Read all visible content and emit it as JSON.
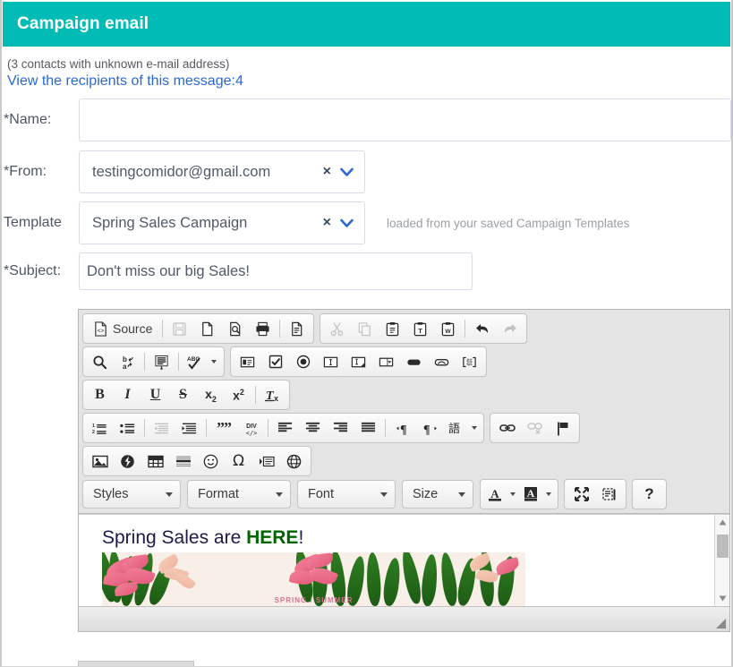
{
  "header": {
    "title": "Campaign email"
  },
  "info": {
    "unknown_note": "(3 contacts with unknown e-mail address)",
    "recipients_link": "View the recipients of this message:4"
  },
  "form": {
    "name": {
      "label": "*Name:",
      "value": "",
      "placeholder": ""
    },
    "from": {
      "label": "*From:",
      "value": "testingcomidor@gmail.com",
      "clear": "×"
    },
    "template": {
      "label": "Template",
      "value": "Spring Sales Campaign",
      "clear": "×",
      "hint": "loaded from your saved Campaign Templates"
    },
    "subject": {
      "label": "*Subject:",
      "value": "Don't miss our big Sales!",
      "placeholder": ""
    }
  },
  "editor": {
    "toolbar": {
      "rows": [
        {
          "groups": [
            {
              "items": [
                {
                  "name": "source-button",
                  "label": "Source",
                  "icon": "source-icon",
                  "disabled": false
                },
                {
                  "name": "separator",
                  "icon": "separator"
                },
                {
                  "name": "save-button",
                  "label": "",
                  "icon": "save-icon",
                  "disabled": true
                },
                {
                  "name": "new-page-button",
                  "label": "",
                  "icon": "new-page-icon",
                  "disabled": false
                },
                {
                  "name": "preview-button",
                  "label": "",
                  "icon": "preview-icon",
                  "disabled": false
                },
                {
                  "name": "print-button",
                  "label": "",
                  "icon": "print-icon",
                  "disabled": false
                },
                {
                  "name": "separator",
                  "icon": "separator"
                },
                {
                  "name": "templates-button",
                  "label": "",
                  "icon": "templates-icon",
                  "disabled": false
                }
              ]
            },
            {
              "items": [
                {
                  "name": "cut-button",
                  "label": "",
                  "icon": "scissors-icon",
                  "disabled": true
                },
                {
                  "name": "copy-button",
                  "label": "",
                  "icon": "copy-icon",
                  "disabled": true
                },
                {
                  "name": "paste-button",
                  "label": "",
                  "icon": "paste-icon",
                  "disabled": false
                },
                {
                  "name": "paste-text-button",
                  "label": "",
                  "icon": "paste-text-icon",
                  "disabled": false
                },
                {
                  "name": "paste-word-button",
                  "label": "",
                  "icon": "paste-word-icon",
                  "disabled": false
                },
                {
                  "name": "separator",
                  "icon": "separator"
                },
                {
                  "name": "undo-button",
                  "label": "",
                  "icon": "undo-arrow-icon",
                  "disabled": false
                },
                {
                  "name": "redo-button",
                  "label": "",
                  "icon": "redo-arrow-icon",
                  "disabled": true
                }
              ]
            }
          ]
        },
        {
          "groups": [
            {
              "items": [
                {
                  "name": "find-button",
                  "label": "",
                  "icon": "magnifier-icon",
                  "disabled": false
                },
                {
                  "name": "replace-button",
                  "label": "",
                  "icon": "replace-icon",
                  "disabled": false
                },
                {
                  "name": "separator",
                  "icon": "separator"
                },
                {
                  "name": "select-all-button",
                  "label": "",
                  "icon": "select-all-icon",
                  "disabled": false
                },
                {
                  "name": "separator",
                  "icon": "separator"
                },
                {
                  "name": "spellcheck-button",
                  "label": "",
                  "icon": "spellcheck-icon",
                  "disabled": false,
                  "caret": true
                }
              ]
            },
            {
              "items": [
                {
                  "name": "form-button",
                  "label": "",
                  "icon": "form-icon",
                  "disabled": false
                },
                {
                  "name": "checkbox-button",
                  "label": "",
                  "icon": "checkbox-icon",
                  "disabled": false
                },
                {
                  "name": "radio-button",
                  "label": "",
                  "icon": "radio-icon",
                  "disabled": false
                },
                {
                  "name": "text-field-button",
                  "label": "",
                  "icon": "text-field-icon",
                  "disabled": false
                },
                {
                  "name": "textarea-button",
                  "label": "",
                  "icon": "textarea-icon",
                  "disabled": false
                },
                {
                  "name": "select-field-button",
                  "label": "",
                  "icon": "select-field-icon",
                  "disabled": false
                },
                {
                  "name": "button-field-button",
                  "label": "",
                  "icon": "button-field-icon",
                  "disabled": false
                },
                {
                  "name": "image-button-button",
                  "label": "",
                  "icon": "image-button-icon",
                  "disabled": false
                },
                {
                  "name": "hidden-field-button",
                  "label": "",
                  "icon": "hidden-field-icon",
                  "disabled": false
                }
              ]
            }
          ]
        },
        {
          "groups": [
            {
              "items": [
                {
                  "name": "bold-button",
                  "label": "B",
                  "icon": "bold-icon",
                  "disabled": false
                },
                {
                  "name": "italic-button",
                  "label": "I",
                  "icon": "italic-icon",
                  "disabled": false
                },
                {
                  "name": "underline-button",
                  "label": "U",
                  "icon": "underline-icon",
                  "disabled": false
                },
                {
                  "name": "strikethrough-button",
                  "label": "S",
                  "icon": "strikethrough-icon",
                  "disabled": false
                },
                {
                  "name": "subscript-button",
                  "label": "x",
                  "icon": "subscript-icon",
                  "disabled": false
                },
                {
                  "name": "superscript-button",
                  "label": "x",
                  "icon": "superscript-icon",
                  "disabled": false
                },
                {
                  "name": "separator",
                  "icon": "separator"
                },
                {
                  "name": "remove-format-button",
                  "label": "",
                  "icon": "remove-format-icon",
                  "disabled": false
                }
              ]
            }
          ]
        },
        {
          "groups": [
            {
              "items": [
                {
                  "name": "numbered-list-button",
                  "label": "",
                  "icon": "numbered-list-icon",
                  "disabled": false
                },
                {
                  "name": "bulleted-list-button",
                  "label": "",
                  "icon": "bulleted-list-icon",
                  "disabled": false
                },
                {
                  "name": "separator",
                  "icon": "separator"
                },
                {
                  "name": "decrease-indent-button",
                  "label": "",
                  "icon": "outdent-icon",
                  "disabled": true
                },
                {
                  "name": "increase-indent-button",
                  "label": "",
                  "icon": "indent-icon",
                  "disabled": false
                },
                {
                  "name": "separator",
                  "icon": "separator"
                },
                {
                  "name": "blockquote-button",
                  "label": "",
                  "icon": "quote-icon",
                  "disabled": false
                },
                {
                  "name": "div-container-button",
                  "label": "",
                  "icon": "div-icon",
                  "disabled": false
                },
                {
                  "name": "separator",
                  "icon": "separator"
                },
                {
                  "name": "align-left-button",
                  "label": "",
                  "icon": "align-left-icon",
                  "disabled": false
                },
                {
                  "name": "align-center-button",
                  "label": "",
                  "icon": "align-center-icon",
                  "disabled": false
                },
                {
                  "name": "align-right-button",
                  "label": "",
                  "icon": "align-right-icon",
                  "disabled": false
                },
                {
                  "name": "align-justify-button",
                  "label": "",
                  "icon": "align-justify-icon",
                  "disabled": false
                },
                {
                  "name": "separator",
                  "icon": "separator"
                },
                {
                  "name": "ltr-button",
                  "label": "",
                  "icon": "text-direction-ltr-icon",
                  "disabled": false
                },
                {
                  "name": "rtl-button",
                  "label": "",
                  "icon": "text-direction-rtl-icon",
                  "disabled": false
                },
                {
                  "name": "language-button",
                  "label": "",
                  "icon": "language-icon",
                  "disabled": false,
                  "caret": true
                }
              ]
            },
            {
              "items": [
                {
                  "name": "link-button",
                  "label": "",
                  "icon": "link-icon",
                  "disabled": false
                },
                {
                  "name": "unlink-button",
                  "label": "",
                  "icon": "unlink-icon",
                  "disabled": true
                },
                {
                  "name": "anchor-button",
                  "label": "",
                  "icon": "flag-icon",
                  "disabled": false
                }
              ]
            }
          ]
        },
        {
          "groups": [
            {
              "items": [
                {
                  "name": "image-button",
                  "label": "",
                  "icon": "image-icon",
                  "disabled": false
                },
                {
                  "name": "flash-button",
                  "label": "",
                  "icon": "flash-icon",
                  "disabled": false
                },
                {
                  "name": "table-button",
                  "label": "",
                  "icon": "table-icon",
                  "disabled": false
                },
                {
                  "name": "horizontal-rule-button",
                  "label": "",
                  "icon": "horizontal-rule-icon",
                  "disabled": false
                },
                {
                  "name": "smiley-button",
                  "label": "",
                  "icon": "smiley-icon",
                  "disabled": false
                },
                {
                  "name": "special-char-button",
                  "label": "",
                  "icon": "omega-icon",
                  "disabled": false
                },
                {
                  "name": "page-break-button",
                  "label": "",
                  "icon": "page-break-icon",
                  "disabled": false
                },
                {
                  "name": "iframe-button",
                  "label": "",
                  "icon": "globe-icon",
                  "disabled": false
                }
              ]
            }
          ]
        }
      ],
      "combos": [
        {
          "name": "styles-combo",
          "label": "Styles"
        },
        {
          "name": "format-combo",
          "label": "Format"
        },
        {
          "name": "font-combo",
          "label": "Font"
        },
        {
          "name": "size-combo",
          "label": "Size"
        }
      ],
      "last_group": [
        {
          "name": "text-color-button",
          "label": "A",
          "icon": "text-color-icon",
          "caret": true
        },
        {
          "name": "background-color-button",
          "label": "A",
          "icon": "background-color-icon",
          "caret": true
        }
      ],
      "tail_buttons": [
        {
          "name": "maximize-button",
          "icon": "maximize-icon"
        },
        {
          "name": "show-blocks-button",
          "icon": "show-blocks-icon"
        }
      ],
      "help_button": {
        "name": "about-button",
        "label": "?",
        "icon": "question-mark-icon"
      }
    },
    "content": {
      "heading_prefix": "Spring Sales are ",
      "heading_highlight": "HERE",
      "heading_suffix": "!",
      "banner_label": "SPRING / SUMMER"
    }
  },
  "colors": {
    "header_teal": "#00bcb4",
    "link_blue": "#2a68d4",
    "label_slate": "#4c5664",
    "heading_navy": "#1b1b4a",
    "highlight_green": "#006400",
    "hint_gray": "#9aa0a6",
    "banner_cream": "#f7efe8",
    "banner_pink": "#e05777",
    "banner_green": "#2f7d22"
  }
}
